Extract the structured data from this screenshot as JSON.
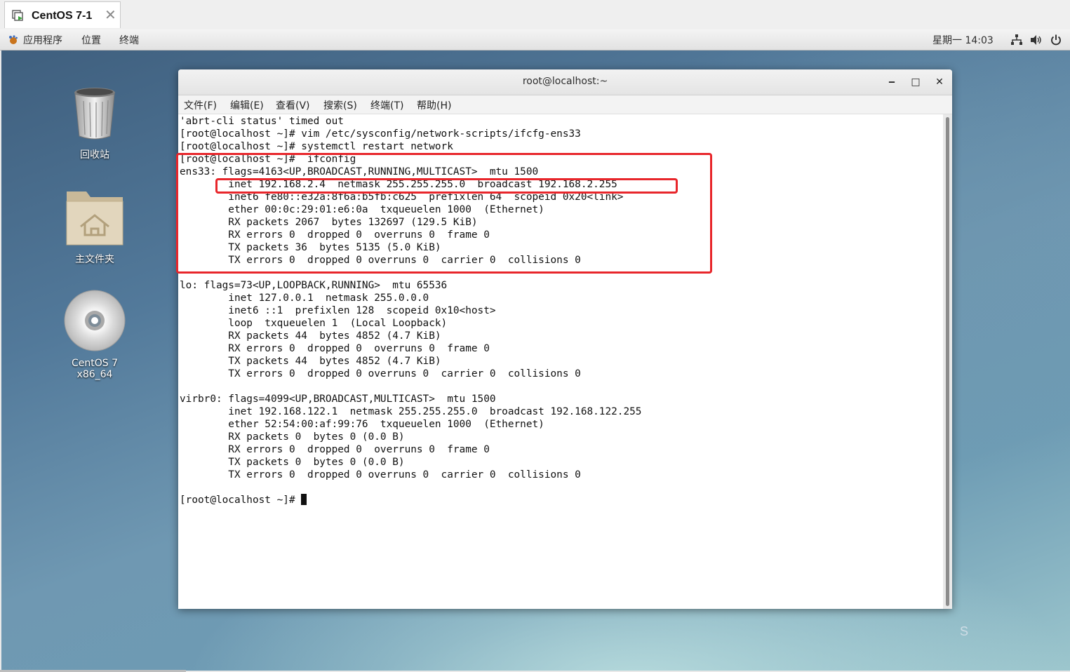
{
  "vm_tab": {
    "title": "CentOS 7-1",
    "close": "✕"
  },
  "panel": {
    "menus": [
      "应用程序",
      "位置",
      "终端"
    ],
    "clock": "星期一 14:03"
  },
  "desktop_icons": [
    {
      "label": "回收站",
      "icon": "trash-icon"
    },
    {
      "label": "主文件夹",
      "icon": "home-folder-icon"
    },
    {
      "label": "CentOS 7 x86_64",
      "icon": "disc-icon"
    }
  ],
  "terminal": {
    "title": "root@localhost:~",
    "buttons": {
      "minimize": "‒",
      "maximize": "□",
      "close": "✕"
    },
    "menus": [
      "文件(F)",
      "编辑(E)",
      "查看(V)",
      "搜索(S)",
      "终端(T)",
      "帮助(H)"
    ],
    "lines": [
      "'abrt-cli status' timed out",
      "[root@localhost ~]# vim /etc/sysconfig/network-scripts/ifcfg-ens33",
      "[root@localhost ~]# systemctl restart network",
      "[root@localhost ~]#  ifconfig",
      "ens33: flags=4163<UP,BROADCAST,RUNNING,MULTICAST>  mtu 1500",
      "        inet 192.168.2.4  netmask 255.255.255.0  broadcast 192.168.2.255",
      "        inet6 fe80::e32a:8f6a:b5fb:c625  prefixlen 64  scopeid 0x20<link>",
      "        ether 00:0c:29:01:e6:0a  txqueuelen 1000  (Ethernet)",
      "        RX packets 2067  bytes 132697 (129.5 KiB)",
      "        RX errors 0  dropped 0  overruns 0  frame 0",
      "        TX packets 36  bytes 5135 (5.0 KiB)",
      "        TX errors 0  dropped 0 overruns 0  carrier 0  collisions 0",
      "",
      "lo: flags=73<UP,LOOPBACK,RUNNING>  mtu 65536",
      "        inet 127.0.0.1  netmask 255.0.0.0",
      "        inet6 ::1  prefixlen 128  scopeid 0x10<host>",
      "        loop  txqueuelen 1  (Local Loopback)",
      "        RX packets 44  bytes 4852 (4.7 KiB)",
      "        RX errors 0  dropped 0  overruns 0  frame 0",
      "        TX packets 44  bytes 4852 (4.7 KiB)",
      "        TX errors 0  dropped 0 overruns 0  carrier 0  collisions 0",
      "",
      "virbr0: flags=4099<UP,BROADCAST,MULTICAST>  mtu 1500",
      "        inet 192.168.122.1  netmask 255.255.255.0  broadcast 192.168.122.255",
      "        ether 52:54:00:af:99:76  txqueuelen 1000  (Ethernet)",
      "        RX packets 0  bytes 0 (0.0 B)",
      "        RX errors 0  dropped 0  overruns 0  frame 0",
      "        TX packets 0  bytes 0 (0.0 B)",
      "        TX errors 0  dropped 0 overruns 0  carrier 0  collisions 0",
      "",
      "[root@localhost ~]# "
    ]
  },
  "desktop_edge_letter": "S",
  "colors": {
    "highlight_box": "#e8262b",
    "terminal_bg": "#ffffff"
  }
}
